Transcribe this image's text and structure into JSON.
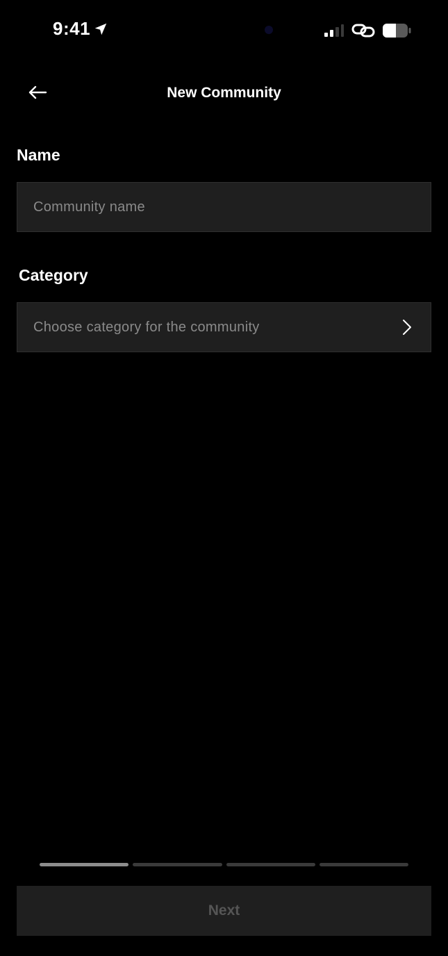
{
  "status_bar": {
    "time": "9:41",
    "icons": [
      "location-arrow-icon",
      "signal-icon",
      "link-icon",
      "battery-icon"
    ]
  },
  "header": {
    "title": "New Community",
    "back_icon": "arrow-left-icon"
  },
  "form": {
    "name": {
      "label": "Name",
      "value": "",
      "placeholder": "Community name"
    },
    "category": {
      "label": "Category",
      "placeholder": "Choose category for the community",
      "icon": "chevron-right-icon"
    }
  },
  "progress": {
    "total_steps": 4,
    "current_step": 1
  },
  "footer": {
    "next_label": "Next"
  },
  "colors": {
    "background": "#000000",
    "field_background": "#1f1f1f",
    "placeholder_text": "#8a8a8a",
    "disabled_button_text": "#555555",
    "progress_active": "#8c8c8c",
    "progress_inactive": "#3a3a3a"
  }
}
